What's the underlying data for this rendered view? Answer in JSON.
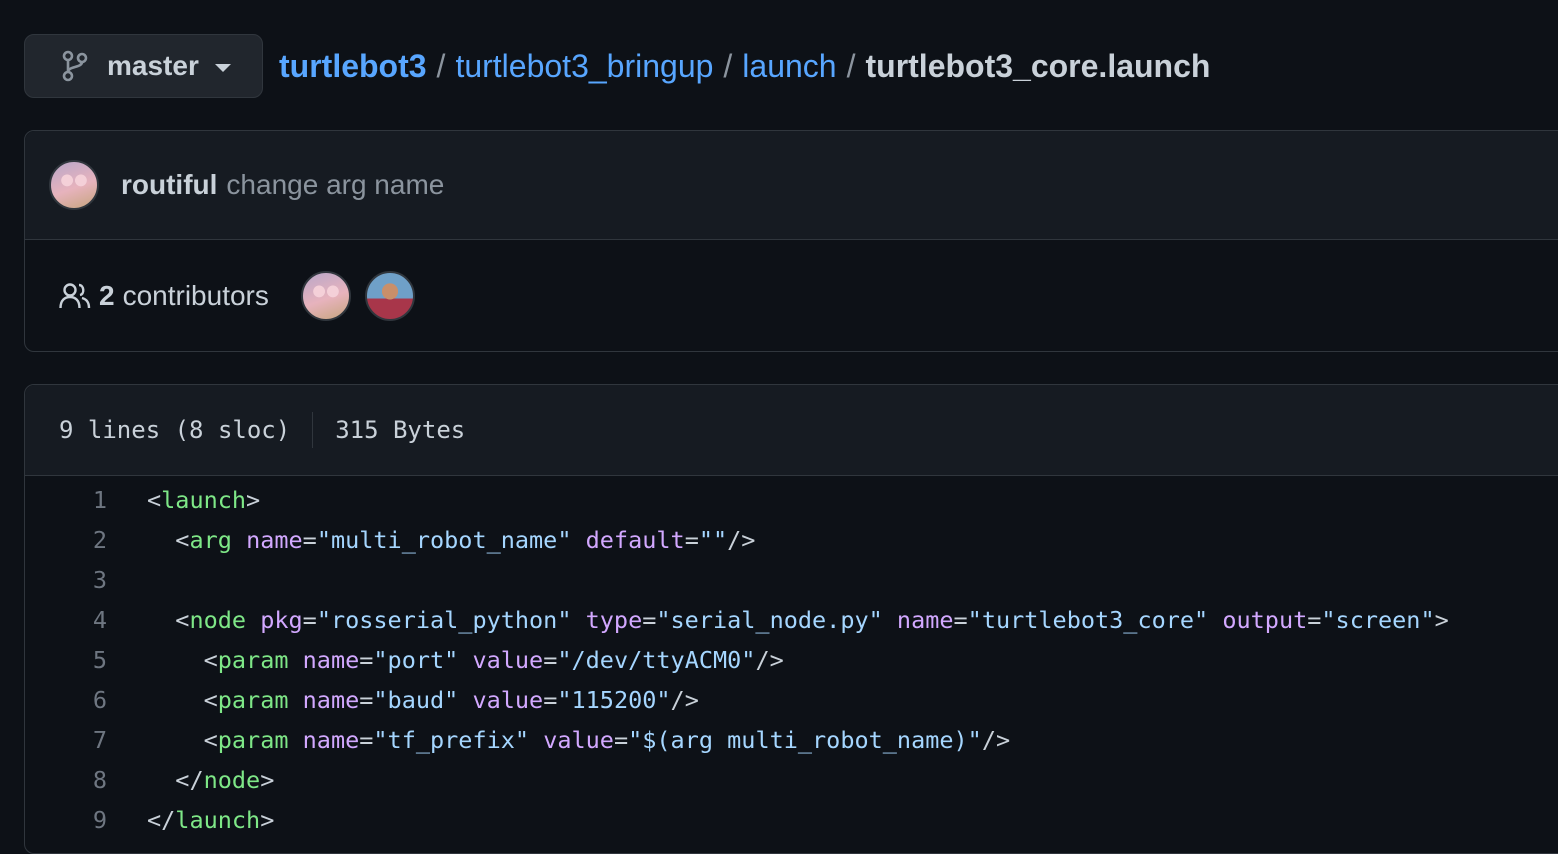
{
  "branch": {
    "name": "master"
  },
  "breadcrumb": {
    "repo": "turtlebot3",
    "dir1": "turtlebot3_bringup",
    "dir2": "launch",
    "file": "turtlebot3_core.launch",
    "separator": "/"
  },
  "commit": {
    "author": "routiful",
    "message": "change arg name"
  },
  "contributors": {
    "count": "2",
    "label": "contributors"
  },
  "file_info": {
    "lines": "9 lines (8 sloc)",
    "size": "315 Bytes"
  },
  "code": [
    {
      "num": "1",
      "tokens": [
        [
          "punc",
          "<"
        ],
        [
          "tag",
          "launch"
        ],
        [
          "punc",
          ">"
        ]
      ]
    },
    {
      "num": "2",
      "tokens": [
        [
          "punc",
          "  <"
        ],
        [
          "tag",
          "arg"
        ],
        [
          "punc",
          " "
        ],
        [
          "attr",
          "name"
        ],
        [
          "punc",
          "="
        ],
        [
          "str",
          "\"multi_robot_name\""
        ],
        [
          "punc",
          " "
        ],
        [
          "attr",
          "default"
        ],
        [
          "punc",
          "="
        ],
        [
          "str",
          "\"\""
        ],
        [
          "punc",
          "/>"
        ]
      ]
    },
    {
      "num": "3",
      "tokens": []
    },
    {
      "num": "4",
      "tokens": [
        [
          "punc",
          "  <"
        ],
        [
          "tag",
          "node"
        ],
        [
          "punc",
          " "
        ],
        [
          "attr",
          "pkg"
        ],
        [
          "punc",
          "="
        ],
        [
          "str",
          "\"rosserial_python\""
        ],
        [
          "punc",
          " "
        ],
        [
          "attr",
          "type"
        ],
        [
          "punc",
          "="
        ],
        [
          "str",
          "\"serial_node.py\""
        ],
        [
          "punc",
          " "
        ],
        [
          "attr",
          "name"
        ],
        [
          "punc",
          "="
        ],
        [
          "str",
          "\"turtlebot3_core\""
        ],
        [
          "punc",
          " "
        ],
        [
          "attr",
          "output"
        ],
        [
          "punc",
          "="
        ],
        [
          "str",
          "\"screen\""
        ],
        [
          "punc",
          ">"
        ]
      ]
    },
    {
      "num": "5",
      "tokens": [
        [
          "punc",
          "    <"
        ],
        [
          "tag",
          "param"
        ],
        [
          "punc",
          " "
        ],
        [
          "attr",
          "name"
        ],
        [
          "punc",
          "="
        ],
        [
          "str",
          "\"port\""
        ],
        [
          "punc",
          " "
        ],
        [
          "attr",
          "value"
        ],
        [
          "punc",
          "="
        ],
        [
          "str",
          "\"/dev/ttyACM0\""
        ],
        [
          "punc",
          "/>"
        ]
      ]
    },
    {
      "num": "6",
      "tokens": [
        [
          "punc",
          "    <"
        ],
        [
          "tag",
          "param"
        ],
        [
          "punc",
          " "
        ],
        [
          "attr",
          "name"
        ],
        [
          "punc",
          "="
        ],
        [
          "str",
          "\"baud\""
        ],
        [
          "punc",
          " "
        ],
        [
          "attr",
          "value"
        ],
        [
          "punc",
          "="
        ],
        [
          "str",
          "\"115200\""
        ],
        [
          "punc",
          "/>"
        ]
      ]
    },
    {
      "num": "7",
      "tokens": [
        [
          "punc",
          "    <"
        ],
        [
          "tag",
          "param"
        ],
        [
          "punc",
          " "
        ],
        [
          "attr",
          "name"
        ],
        [
          "punc",
          "="
        ],
        [
          "str",
          "\"tf_prefix\""
        ],
        [
          "punc",
          " "
        ],
        [
          "attr",
          "value"
        ],
        [
          "punc",
          "="
        ],
        [
          "str",
          "\"$(arg multi_robot_name)\""
        ],
        [
          "punc",
          "/>"
        ]
      ]
    },
    {
      "num": "8",
      "tokens": [
        [
          "punc",
          "  </"
        ],
        [
          "tag",
          "node"
        ],
        [
          "punc",
          ">"
        ]
      ]
    },
    {
      "num": "9",
      "tokens": [
        [
          "punc",
          "</"
        ],
        [
          "tag",
          "launch"
        ],
        [
          "punc",
          ">"
        ]
      ]
    }
  ]
}
